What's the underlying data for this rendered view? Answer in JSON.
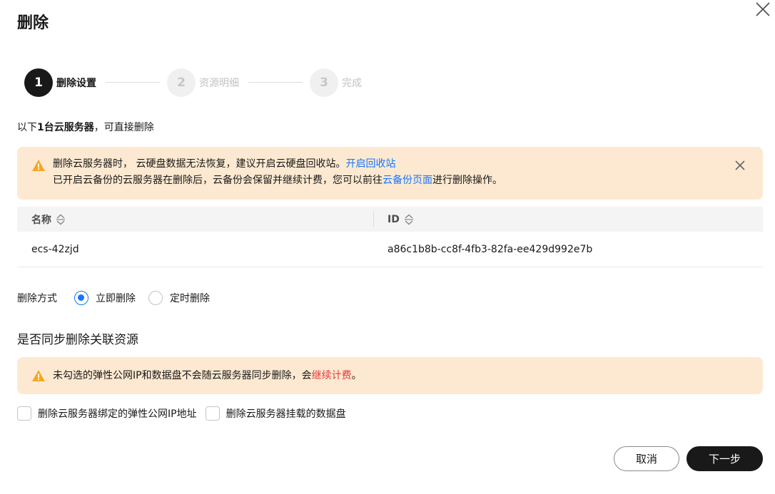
{
  "dialog": {
    "title": "删除"
  },
  "steps": [
    {
      "number": "1",
      "label": "删除设置",
      "state": "active"
    },
    {
      "number": "2",
      "label": "资源明细",
      "state": "inactive"
    },
    {
      "number": "3",
      "label": "完成",
      "state": "inactive"
    }
  ],
  "intro": {
    "prefix": "以下",
    "count_text": "1台云服务器",
    "suffix": "，可直接删除"
  },
  "alert1": {
    "line1_text": "删除云服务器时， 云硬盘数据无法恢复，建议开启云硬盘回收站。",
    "line1_link": "开启回收站",
    "line2_text_a": "已开启云备份的云服务器在删除后，云备份会保留并继续计费，您可以前往",
    "line2_link": "云备份页面",
    "line2_text_b": "进行删除操作。"
  },
  "table": {
    "columns": [
      "名称",
      "ID"
    ],
    "rows": [
      {
        "name": "ecs-42zjd",
        "id": "a86c1b8b-cc8f-4fb3-82fa-ee429d992e7b"
      }
    ]
  },
  "delete_mode": {
    "label": "删除方式",
    "options": [
      {
        "label": "立即删除",
        "checked": true
      },
      {
        "label": "定时删除",
        "checked": false
      }
    ]
  },
  "related": {
    "title": "是否同步删除关联资源",
    "alert_text": "未勾选的弹性公网IP和数据盘不会随云服务器同步删除，会",
    "alert_link": "继续计费",
    "alert_end": "。",
    "checkboxes": [
      {
        "label": "删除云服务器绑定的弹性公网IP地址",
        "checked": false
      },
      {
        "label": "删除云服务器挂载的数据盘",
        "checked": false
      }
    ]
  },
  "footer": {
    "cancel_label": "取消",
    "next_label": "下一步"
  },
  "colors": {
    "accent": "#1476ff",
    "warning": "#f5a623",
    "danger": "#e43a3a",
    "alert_bg": "#fde9d1",
    "primary_button": "#191919"
  }
}
